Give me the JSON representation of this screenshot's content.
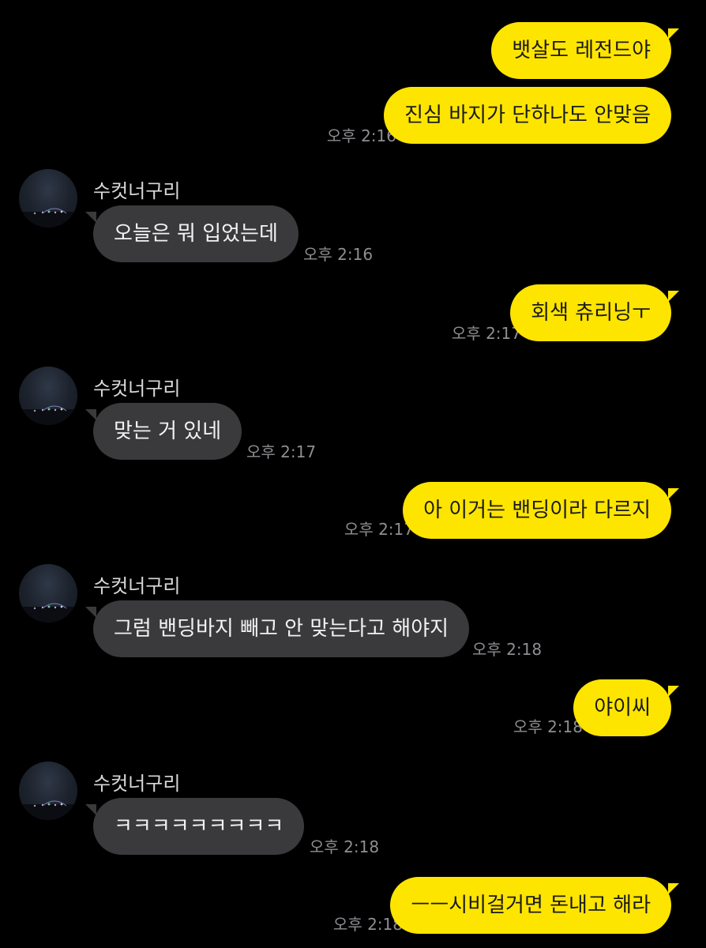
{
  "colors": {
    "background": "#000000",
    "my_bubble": "#FEE500",
    "their_bubble": "#3a3a3c",
    "timestamp": "#8e8e93"
  },
  "contact": {
    "name": "수컷너구리",
    "avatar_icon": "night-city-photo-avatar"
  },
  "messages": [
    {
      "sender": "me",
      "text": "뱃살도 레전드야",
      "time": ""
    },
    {
      "sender": "me",
      "text": "진심 바지가 단하나도 안맞음",
      "time": "오후 2:16"
    },
    {
      "sender": "them",
      "text": "오늘은 뭐 입었는데",
      "time": "오후 2:16"
    },
    {
      "sender": "me",
      "text": "회색 츄리닝ㅜ",
      "time": "오후 2:17"
    },
    {
      "sender": "them",
      "text": "맞는 거 있네",
      "time": "오후 2:17"
    },
    {
      "sender": "me",
      "text": "아 이거는 밴딩이라 다르지",
      "time": "오후 2:17"
    },
    {
      "sender": "them",
      "text": "그럼 밴딩바지 빼고 안 맞는다고 해야지",
      "time": "오후 2:18"
    },
    {
      "sender": "me",
      "text": "야이씨",
      "time": "오후 2:18"
    },
    {
      "sender": "them",
      "text": "ㅋㅋㅋㅋㅋㅋㅋㅋㅋ",
      "time": "오후 2:18"
    },
    {
      "sender": "me",
      "text": "ㅡㅡ시비걸거면 돈내고 해라",
      "time": "오후 2:18"
    }
  ]
}
